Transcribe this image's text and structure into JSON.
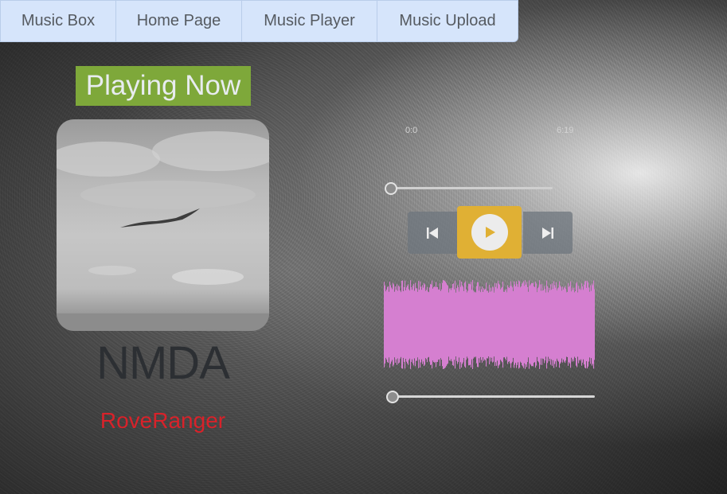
{
  "nav": {
    "items": [
      "Music Box",
      "Home Page",
      "Music Player",
      "Music Upload"
    ]
  },
  "player": {
    "heading": "Playing Now",
    "song_title": "NMDA",
    "artist": "RoveRanger",
    "current_time": "0:0",
    "duration": "6:19",
    "progress_fraction": 0.0,
    "volume_fraction": 0.0
  },
  "icons": {
    "prev": "skip-previous-icon",
    "play": "play-icon",
    "next": "skip-next-icon"
  },
  "colors": {
    "nav_bg": "#d6e5fb",
    "heading_bg": "#7ea83a",
    "artist": "#d8222a",
    "play_button": "#e0b034",
    "waveform": "#d57fd0"
  }
}
